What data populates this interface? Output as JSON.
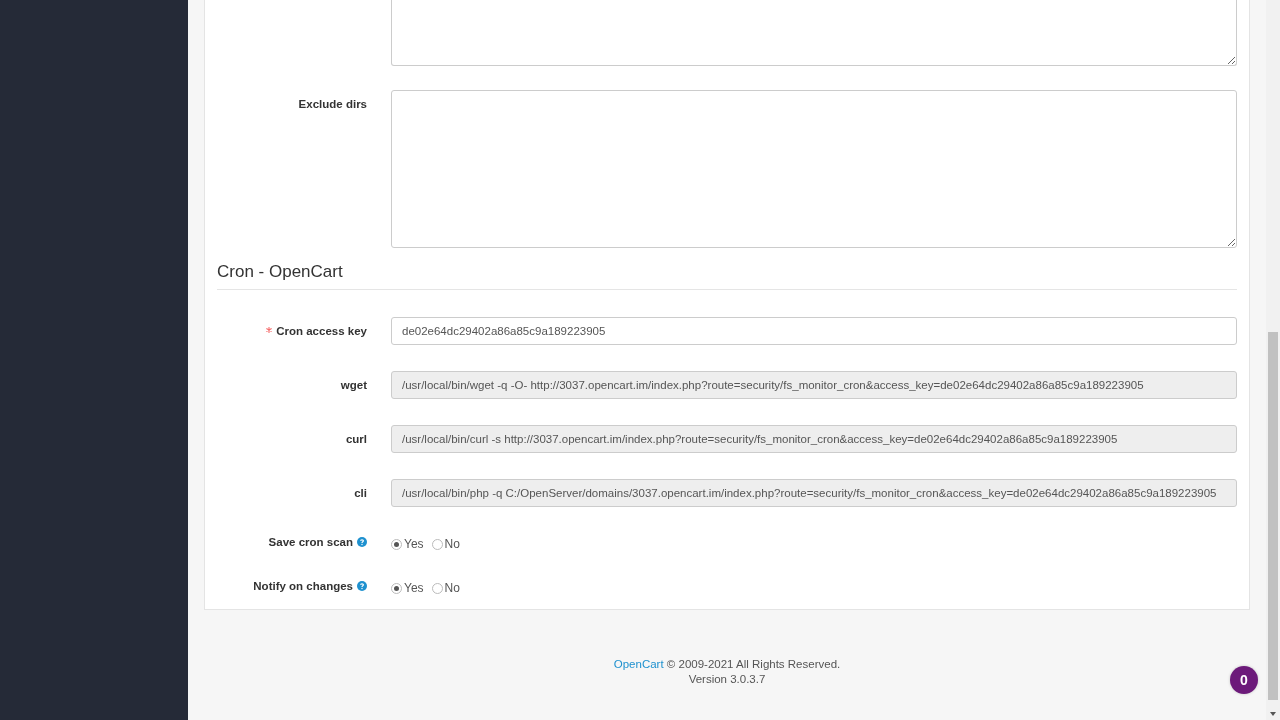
{
  "form": {
    "fields": [
      {
        "kind": "textarea"
      },
      {
        "kind": "textarea",
        "label": "Exclude dirs"
      }
    ],
    "section": {
      "title": "Cron - OpenCart",
      "fields": [
        {
          "kind": "text",
          "label": "Cron access key",
          "required": true,
          "value": "de02e64dc29402a86a85c9a189223905"
        },
        {
          "kind": "readonly",
          "label": "wget",
          "value": "/usr/local/bin/wget -q -O- http://3037.opencart.im/index.php?route=security/fs_monitor_cron&access_key=de02e64dc29402a86a85c9a189223905"
        },
        {
          "kind": "readonly",
          "label": "curl",
          "value": "/usr/local/bin/curl -s http://3037.opencart.im/index.php?route=security/fs_monitor_cron&access_key=de02e64dc29402a86a85c9a189223905"
        },
        {
          "kind": "readonly",
          "label": "cli",
          "value": "/usr/local/bin/php -q C:/OpenServer/domains/3037.opencart.im/index.php?route=security/fs_monitor_cron&access_key=de02e64dc29402a86a85c9a189223905"
        },
        {
          "kind": "radio",
          "label": "Save cron scan",
          "help": true,
          "options": [
            {
              "label": "Yes",
              "selected": true
            },
            {
              "label": "No",
              "selected": false
            }
          ]
        },
        {
          "kind": "radio",
          "label": "Notify on changes",
          "help": true,
          "options": [
            {
              "label": "Yes",
              "selected": true
            },
            {
              "label": "No",
              "selected": false
            }
          ]
        }
      ]
    }
  },
  "footer": {
    "link": "OpenCart",
    "text": "© 2009-2021 All Rights Reserved.",
    "version": "Version 3.0.3.7"
  },
  "badge": {
    "count": "0"
  }
}
